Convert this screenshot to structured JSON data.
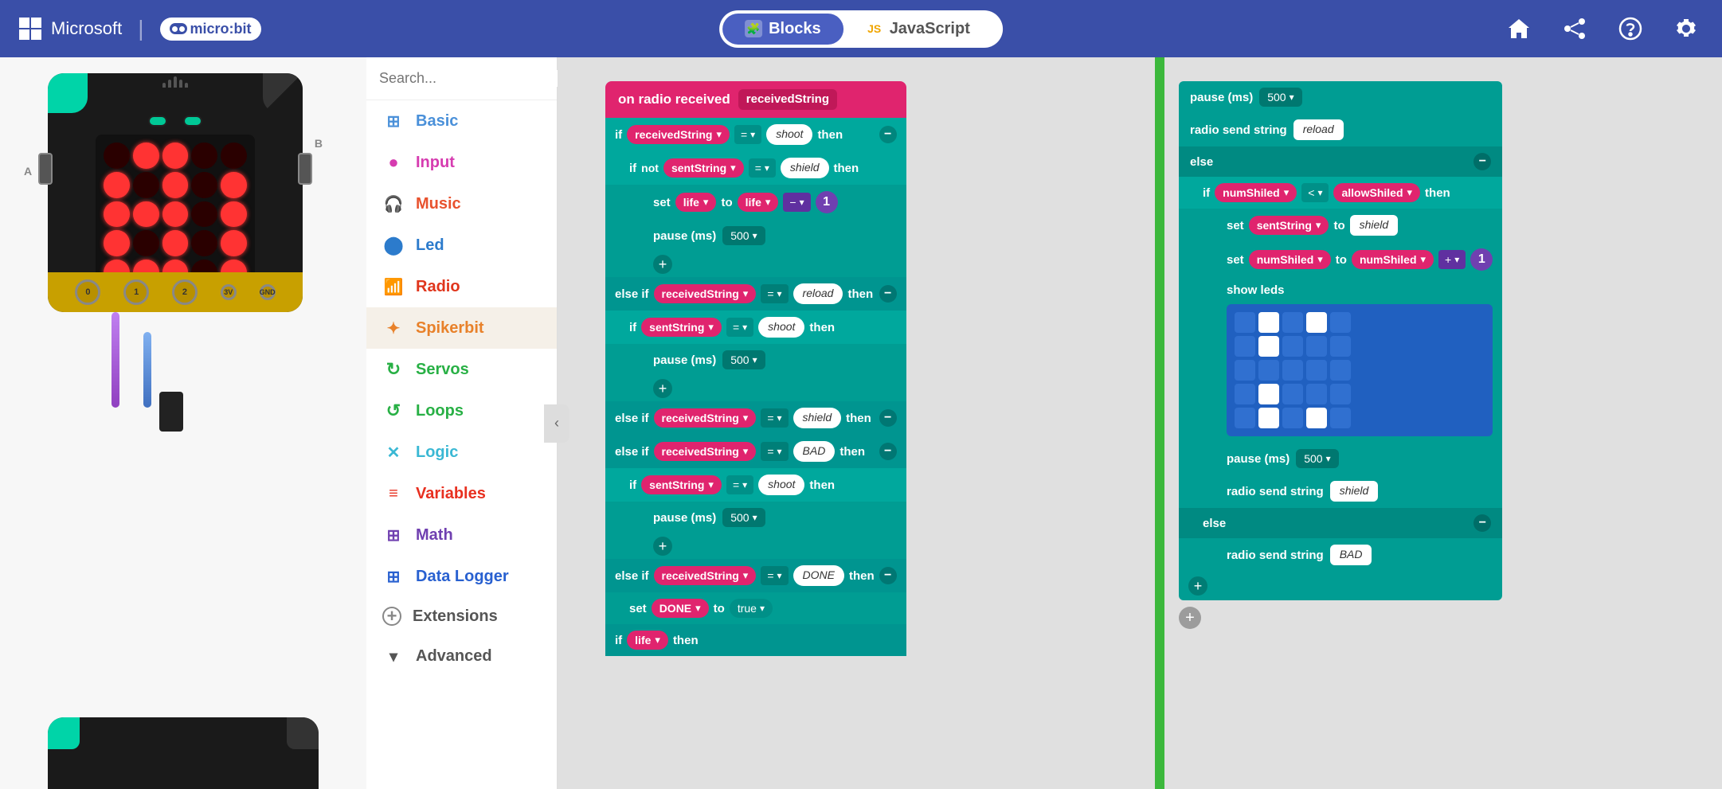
{
  "header": {
    "microsoft_label": "Microsoft",
    "microbit_label": "micro:bit",
    "blocks_label": "Blocks",
    "javascript_label": "JavaScript",
    "tabs": [
      {
        "id": "blocks",
        "label": "Blocks",
        "active": true
      },
      {
        "id": "javascript",
        "label": "JavaScript",
        "active": false
      }
    ]
  },
  "sidebar": {
    "search_placeholder": "Search...",
    "collapse_label": "‹",
    "items": [
      {
        "id": "basic",
        "label": "Basic",
        "color": "#4a90d9",
        "icon": "⊞"
      },
      {
        "id": "input",
        "label": "Input",
        "color": "#d63cb0",
        "icon": "●"
      },
      {
        "id": "music",
        "label": "Music",
        "color": "#e8522e",
        "icon": "🎧"
      },
      {
        "id": "led",
        "label": "Led",
        "color": "#2c7bcc",
        "icon": "●"
      },
      {
        "id": "radio",
        "label": "Radio",
        "color": "#e0351c",
        "icon": "📶"
      },
      {
        "id": "spikerbit",
        "label": "Spikerbit",
        "color": "#e8812a",
        "icon": "✦"
      },
      {
        "id": "servos",
        "label": "Servos",
        "color": "#28b045",
        "icon": "↻"
      },
      {
        "id": "loops",
        "label": "Loops",
        "color": "#28b045",
        "icon": "↺"
      },
      {
        "id": "logic",
        "label": "Logic",
        "color": "#3ab8d4",
        "icon": "✕"
      },
      {
        "id": "variables",
        "label": "Variables",
        "color": "#e83020",
        "icon": "≡"
      },
      {
        "id": "math",
        "label": "Math",
        "color": "#7040b0",
        "icon": "⊞"
      },
      {
        "id": "data_logger",
        "label": "Data Logger",
        "color": "#2860d0",
        "icon": "⊞"
      },
      {
        "id": "extensions",
        "label": "Extensions",
        "color": "#888",
        "icon": "+"
      },
      {
        "id": "advanced",
        "label": "Advanced",
        "color": "#555",
        "icon": "▾"
      }
    ]
  },
  "blocks": {
    "hat_label": "on radio received",
    "received_string": "receivedString",
    "strings": {
      "shoot": "shoot",
      "shield": "shield",
      "reload": "reload",
      "bad": "BAD",
      "done": "DONE"
    },
    "variables": {
      "sentString": "sentString",
      "life": "life",
      "numShiled": "numShiled",
      "allowShiled": "allowShiled",
      "DONE": "DONE"
    },
    "operators": {
      "eq": "= ▾",
      "lt": "< ▾",
      "minus": "-  ▾",
      "plus": "+ ▾",
      "not": "not"
    },
    "keywords": {
      "if": "if",
      "then": "then",
      "else": "else",
      "else_if": "else if",
      "set": "set",
      "to": "to",
      "pause": "pause (ms)",
      "show_leds": "show leds",
      "radio_send": "radio send string",
      "true_val": "true"
    },
    "numbers": {
      "one": "1",
      "five_hundred": "500"
    },
    "led_pattern": [
      [
        false,
        true,
        false,
        true,
        false
      ],
      [
        false,
        true,
        false,
        false,
        false
      ],
      [
        false,
        false,
        false,
        false,
        false
      ],
      [
        false,
        true,
        false,
        false,
        false
      ],
      [
        false,
        true,
        false,
        true,
        false
      ]
    ]
  }
}
